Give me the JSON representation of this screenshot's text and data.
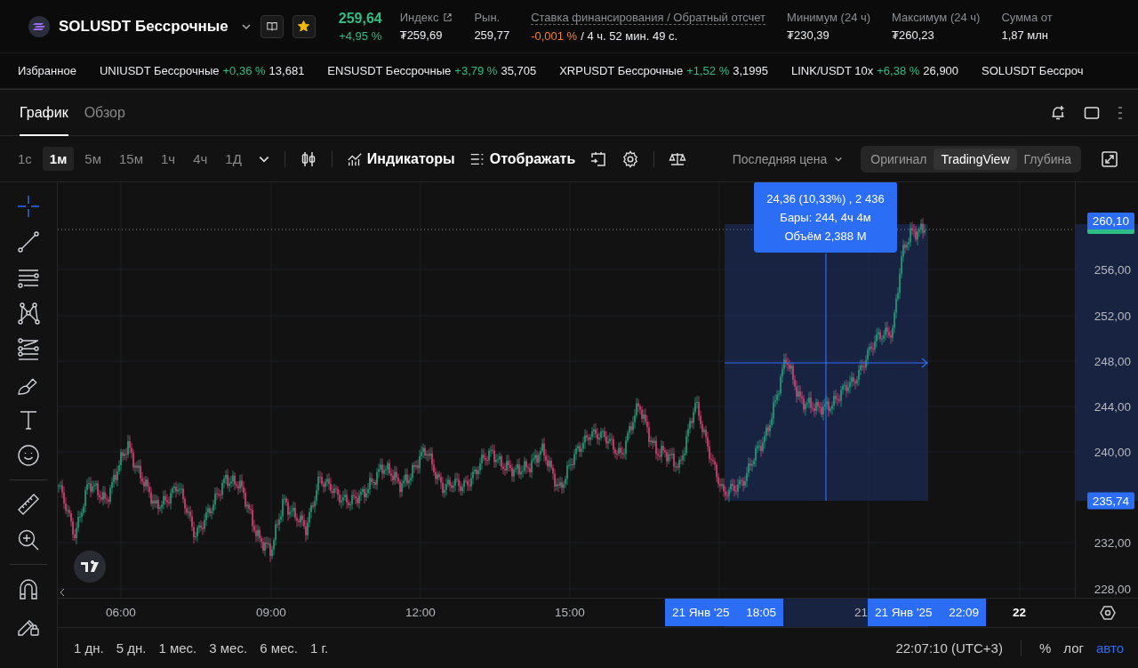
{
  "header": {
    "symbol": "SOLUSDT Бессрочные",
    "favorite": true,
    "price": "259,64",
    "change": "+4,95 %",
    "stats": [
      {
        "kind": "link",
        "label": "Индекс",
        "value": "₮259,69"
      },
      {
        "kind": "plain",
        "label": "Рын.",
        "value": "259,77"
      },
      {
        "kind": "funding",
        "label": "Ставка финансирования / Обратный отсчет",
        "value": "-0,001 %",
        "extra": "/ 4 ч. 52 мин. 49 с."
      },
      {
        "kind": "plain",
        "label": "Минимум (24 ч)",
        "value": "₮230,39"
      },
      {
        "kind": "plain",
        "label": "Максимум (24 ч)",
        "value": "₮260,23"
      },
      {
        "kind": "plain",
        "label": "Сумма от",
        "value": "1,87 млн"
      }
    ]
  },
  "ticker": {
    "label": "Избранное",
    "items": [
      {
        "name": "UNIUSDT Бессрочные",
        "change": "+0,36 %",
        "price": "13,681"
      },
      {
        "name": "ENSUSDT Бессрочные",
        "change": "+3,79 %",
        "price": "35,705"
      },
      {
        "name": "XRPUSDT Бессрочные",
        "change": "+1,52 %",
        "price": "3,1995"
      },
      {
        "name": "LINK/USDT 10x",
        "change": "+6,38 %",
        "price": "26,900"
      },
      {
        "name": "SOLUSDT Бессроч"
      }
    ]
  },
  "chart_panel": {
    "tabs": [
      {
        "label": "График",
        "selected": true
      },
      {
        "label": "Обзор",
        "selected": false
      }
    ],
    "intervals": [
      {
        "label": "1с",
        "selected": false
      },
      {
        "label": "1м",
        "selected": true
      },
      {
        "label": "5м",
        "selected": false
      },
      {
        "label": "15м",
        "selected": false
      },
      {
        "label": "1ч",
        "selected": false
      },
      {
        "label": "4ч",
        "selected": false
      },
      {
        "label": "1Д",
        "selected": false
      }
    ],
    "indicators": "Индикаторы",
    "display": "Отображать",
    "price_source": "Последняя цена",
    "views": [
      {
        "label": "Оригинал",
        "selected": false
      },
      {
        "label": "TradingView",
        "selected": true
      },
      {
        "label": "Глубина",
        "selected": false
      }
    ],
    "tool_groups": [
      [
        {
          "kind": "crosshair",
          "selected": true
        },
        {
          "kind": "line",
          "selected": false
        },
        {
          "kind": "parallel",
          "selected": false
        },
        {
          "kind": "pattern",
          "selected": false
        },
        {
          "kind": "fib",
          "selected": false
        },
        {
          "kind": "brush",
          "selected": false
        },
        {
          "kind": "text",
          "selected": false
        },
        {
          "kind": "emoji",
          "selected": false
        }
      ],
      [
        {
          "kind": "ruler",
          "selected": false
        },
        {
          "kind": "zoom",
          "selected": false
        }
      ],
      [
        {
          "kind": "magnet",
          "selected": false
        },
        {
          "kind": "lock",
          "selected": false
        }
      ]
    ],
    "measure": {
      "lines": [
        "24,36 (10,33%) , 2 436",
        "Бары: 244, 4ч 4м",
        "Объём 2,388 M"
      ]
    },
    "price_axis": [
      {
        "kind": "last",
        "text": "260,10"
      },
      {
        "kind": "tick",
        "text": "256,00"
      },
      {
        "kind": "tick",
        "text": "252,00"
      },
      {
        "kind": "tick",
        "text": "248,00"
      },
      {
        "kind": "tick",
        "text": "244,00"
      },
      {
        "kind": "tick",
        "text": "240,00"
      },
      {
        "kind": "badge",
        "text": "235,74"
      },
      {
        "kind": "tick",
        "text": "232,00"
      },
      {
        "kind": "tick",
        "text": "228,00"
      }
    ],
    "time_axis": [
      {
        "kind": "tick",
        "text": "06:00"
      },
      {
        "kind": "tick",
        "text": "09:00"
      },
      {
        "kind": "tick",
        "text": "12:00"
      },
      {
        "kind": "tick",
        "text": "15:00"
      },
      {
        "kind": "badge",
        "date": "21 Янв '25",
        "text": "18:05"
      },
      {
        "kind": "tick",
        "text": "21"
      },
      {
        "kind": "badge",
        "date": "21 Янв '25",
        "text": "22:09"
      },
      {
        "kind": "bold",
        "text": "22"
      }
    ],
    "ranges": [
      "1 дн.",
      "5 дн.",
      "1 мес.",
      "3 мес.",
      "6 мес.",
      "1 г."
    ],
    "clock": "22:07:10 (UTC+3)",
    "scales": [
      {
        "label": "%",
        "selected": false
      },
      {
        "label": "лог",
        "selected": false
      },
      {
        "label": "авто",
        "selected": true
      }
    ]
  }
}
